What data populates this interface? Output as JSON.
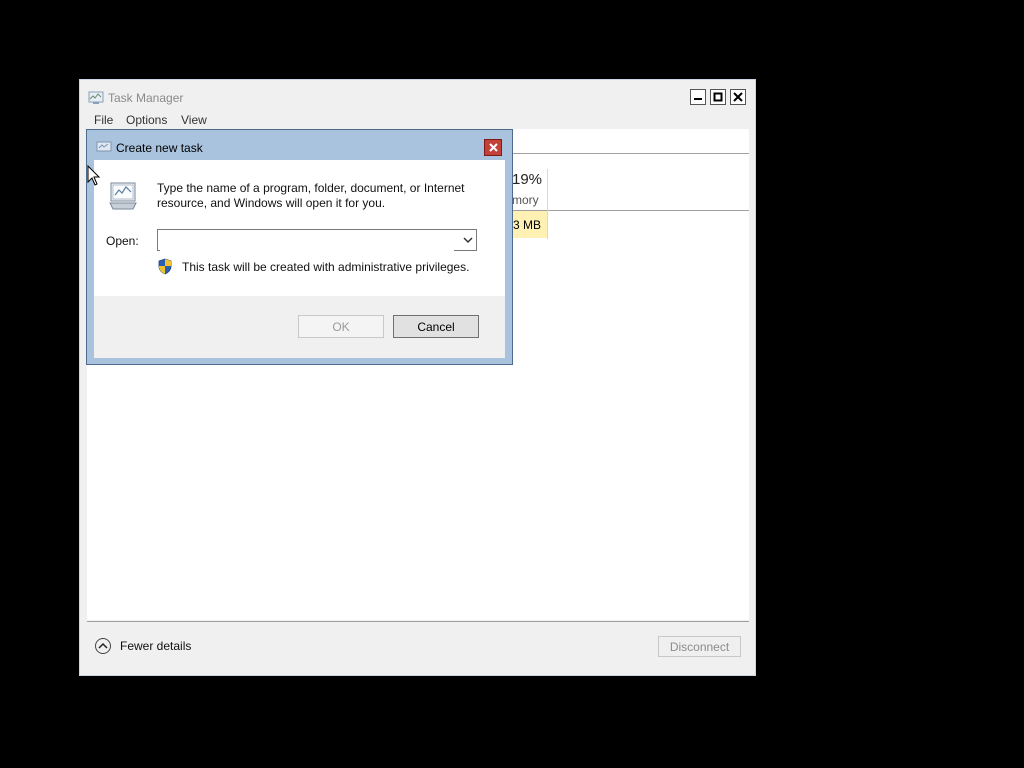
{
  "task_manager": {
    "title": "Task Manager",
    "menu": [
      "File",
      "Options",
      "View"
    ],
    "memory_percent": "19%",
    "memory_label": "mory",
    "memory_value": "3 MB",
    "fewer_details": "Fewer details",
    "disconnect": "Disconnect"
  },
  "dialog": {
    "title": "Create new task",
    "description": "Type the name of a program, folder, document, or Internet resource, and Windows will open it for you.",
    "open_label": "Open:",
    "open_value": "",
    "admin_note": "This task will be created with administrative privileges.",
    "ok_label": "OK",
    "cancel_label": "Cancel"
  },
  "colors": {
    "dialog_frame": "#a9c2de",
    "close_red": "#c4413a",
    "memory_highlight": "#fff0b4"
  },
  "icons": [
    "task-manager-icon",
    "minimize-icon",
    "maximize-icon",
    "close-icon",
    "run-icon",
    "chevron-down-icon",
    "shield-icon",
    "chevron-up-icon",
    "mouse-cursor-icon"
  ]
}
